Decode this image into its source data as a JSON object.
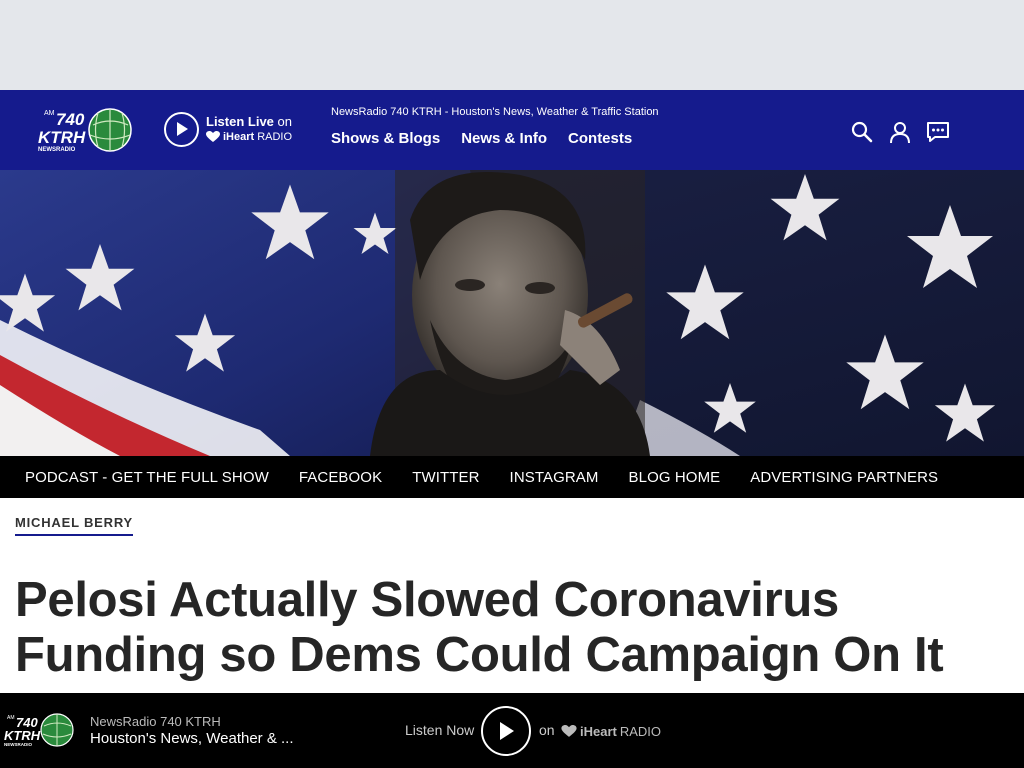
{
  "site": {
    "logo": {
      "am": "AM",
      "frequency": "740",
      "callsign": "KTRH",
      "sub": "NEWSRADIO"
    }
  },
  "header": {
    "listen_live_label": "Listen Live",
    "listen_on": "on",
    "iheart_bold": "iHeart",
    "iheart_rest": "RADIO",
    "station_tagline": "NewsRadio 740 KTRH - Houston's News, Weather & Traffic Station",
    "nav": [
      "Shows & Blogs",
      "News & Info",
      "Contests"
    ],
    "icons": [
      "search-icon",
      "user-icon",
      "chat-icon"
    ]
  },
  "subnav": [
    "PODCAST - GET THE FULL SHOW",
    "FACEBOOK",
    "TWITTER",
    "INSTAGRAM",
    "BLOG HOME",
    "ADVERTISING PARTNERS"
  ],
  "article": {
    "category": "MICHAEL BERRY",
    "headline": "Pelosi Actually Slowed Coronavirus Funding so Dems Could Campaign On It"
  },
  "player": {
    "station_name": "NewsRadio 740 KTRH",
    "station_desc": "Houston's News, Weather & ...",
    "listen_now": "Listen Now",
    "on": "on",
    "iheart_bold": "iHeart",
    "iheart_rest": "RADIO"
  },
  "colors": {
    "nav_blue": "#151b8d",
    "ad_band": "#e4e7eb",
    "subnav_bg": "#000000",
    "headline": "#262626"
  }
}
